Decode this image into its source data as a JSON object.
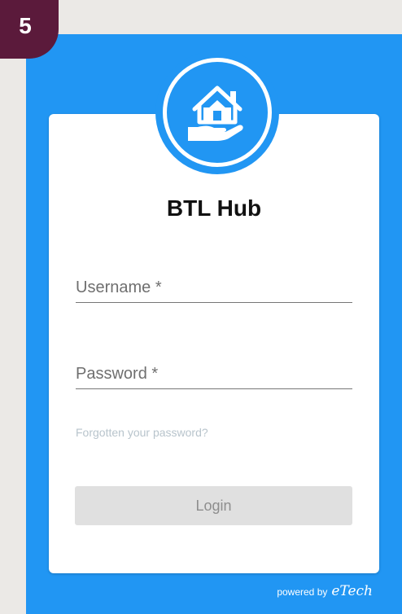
{
  "step_badge": "5",
  "app": {
    "title": "BTL Hub",
    "logo_icon": "house-in-hand-icon",
    "accent_color": "#2196f3"
  },
  "form": {
    "username_placeholder": "Username *",
    "username_value": "",
    "password_placeholder": "Password *",
    "password_value": "",
    "forgot_password_label": "Forgotten your password?",
    "login_label": "Login"
  },
  "footer": {
    "powered_by": "powered by",
    "brand": "eTech"
  }
}
